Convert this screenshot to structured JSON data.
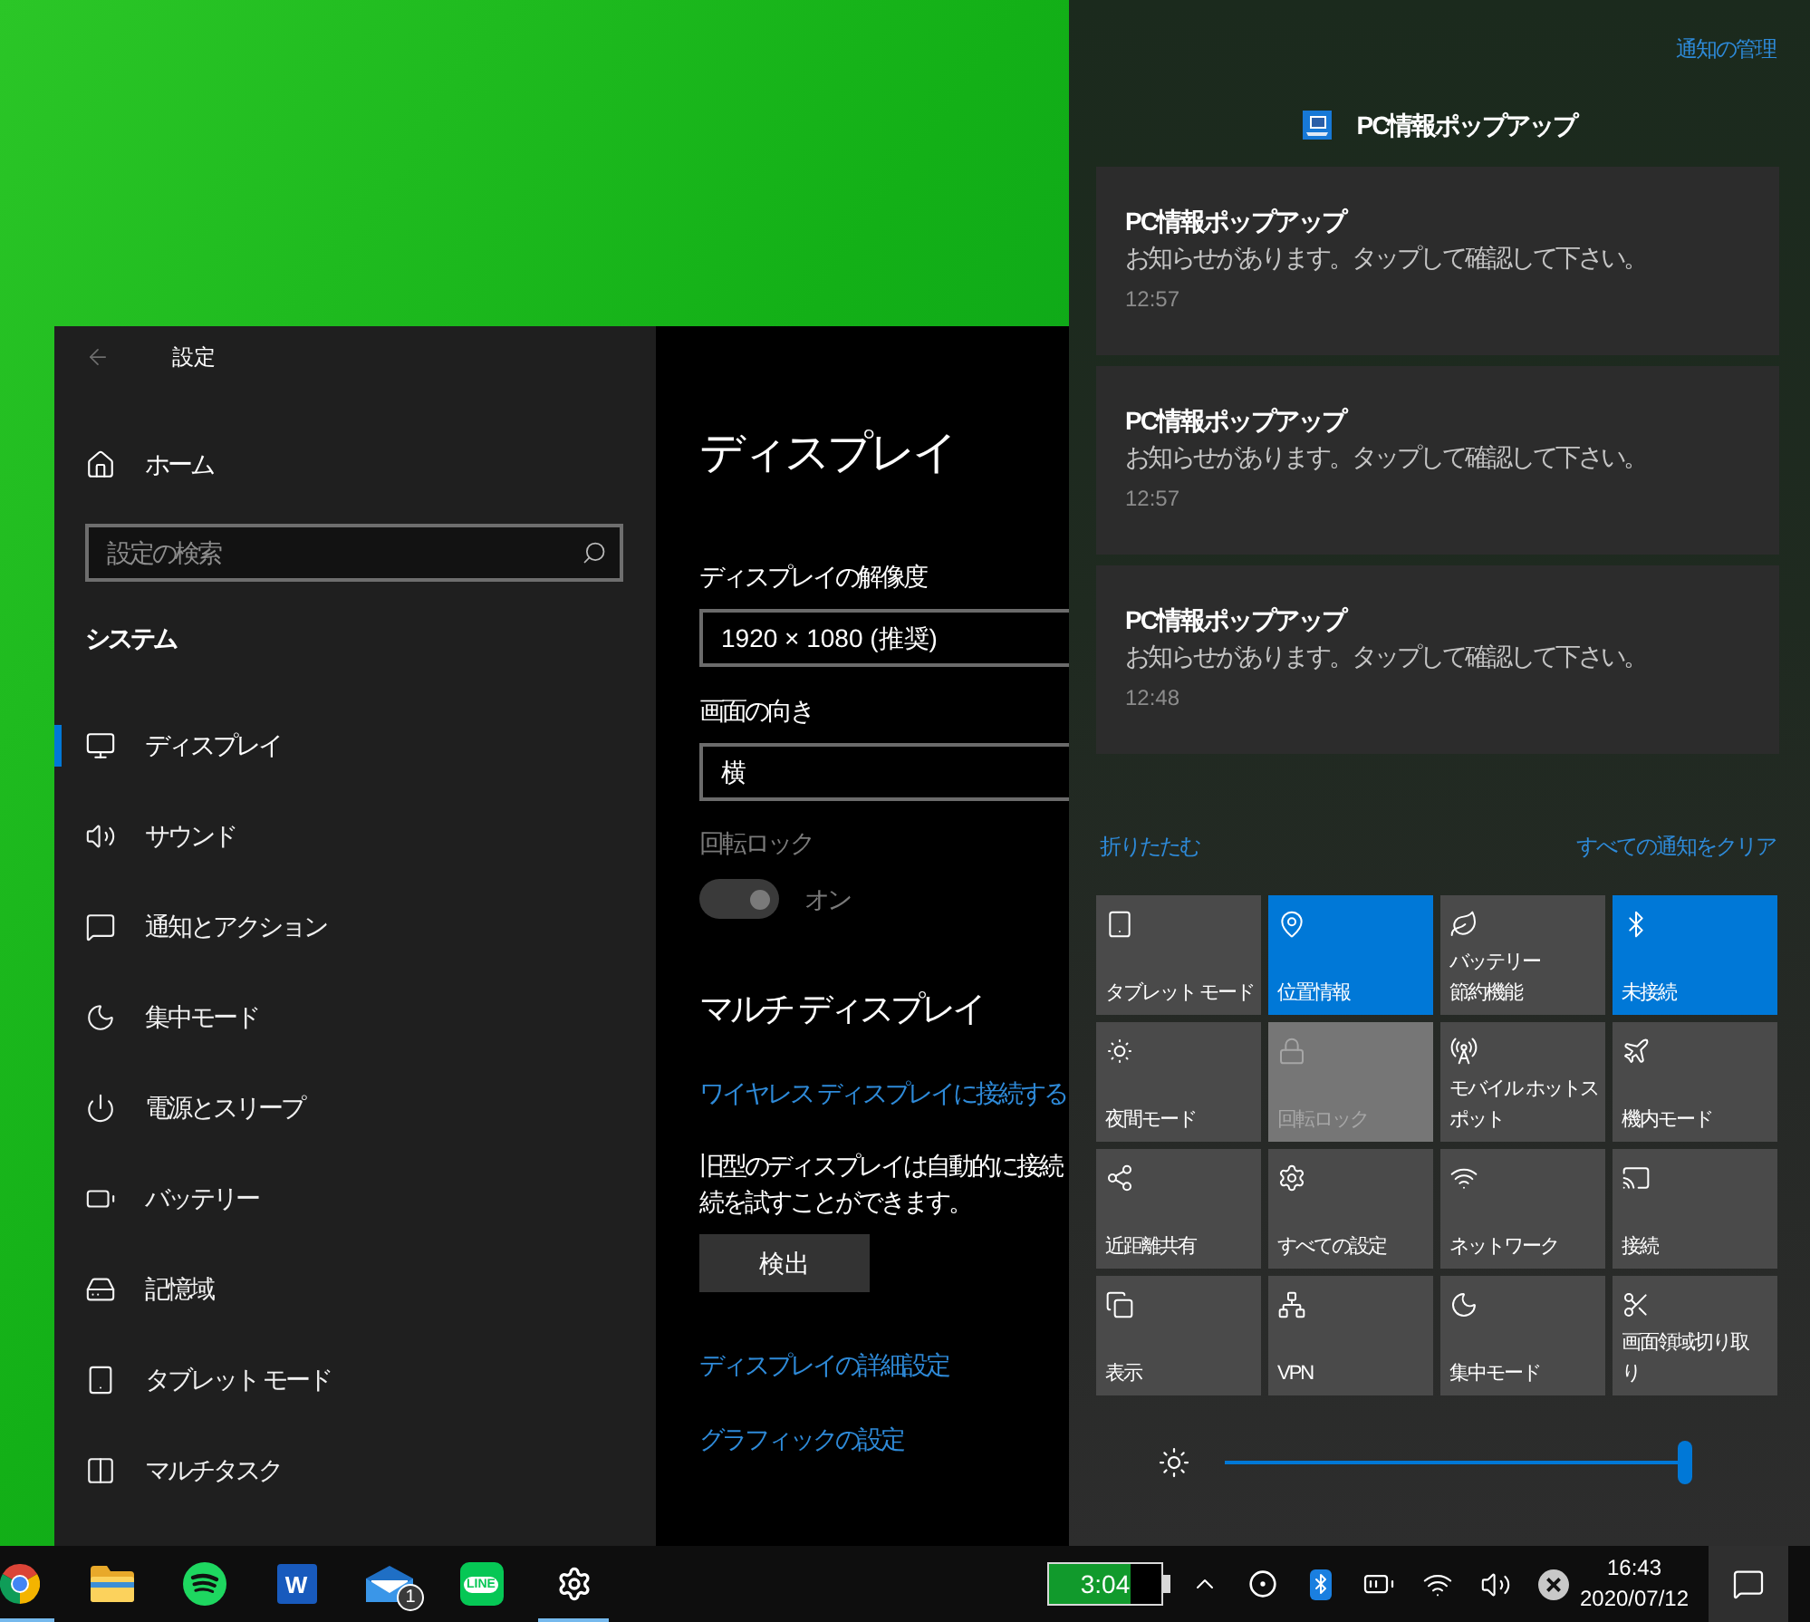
{
  "settings_window": {
    "title": "設定",
    "home": "ホーム",
    "search": {
      "placeholder": "設定の検索"
    },
    "section": "システム",
    "nav_items": [
      {
        "label": "ディスプレイ",
        "selected": true
      },
      {
        "label": "サウンド",
        "selected": false
      },
      {
        "label": "通知とアクション",
        "selected": false
      },
      {
        "label": "集中モード",
        "selected": false
      },
      {
        "label": "電源とスリープ",
        "selected": false
      },
      {
        "label": "バッテリー",
        "selected": false
      },
      {
        "label": "記憶域",
        "selected": false
      },
      {
        "label": "タブレット モード",
        "selected": false
      },
      {
        "label": "マルチタスク",
        "selected": false
      }
    ],
    "page": {
      "heading": "ディスプレイ",
      "resolution": {
        "label": "ディスプレイの解像度",
        "value": "1920 × 1080 (推奨)"
      },
      "orientation": {
        "label": "画面の向き",
        "value": "横"
      },
      "rotation_lock": {
        "label": "回転ロック",
        "on": true,
        "disabled": true,
        "state_text": "オン"
      },
      "multi_display": {
        "heading": "マルチ ディスプレイ",
        "link": "ワイヤレス ディスプレイに接続する",
        "text_lines": [
          "旧型のディスプレイは自動的に接続",
          "続を試すことができます。"
        ],
        "button": "検出"
      },
      "links": [
        "ディスプレイの詳細設定",
        "グラフィックの設定"
      ]
    }
  },
  "action_center": {
    "manage_link": "通知の管理",
    "app_name": "PC情報ポップアップ",
    "notifications": [
      {
        "title": "PC情報ポップアップ",
        "body": "お知らせがあります。タップして確認して下さい。",
        "time": "12:57"
      },
      {
        "title": "PC情報ポップアップ",
        "body": "お知らせがあります。タップして確認して下さい。",
        "time": "12:57"
      },
      {
        "title": "PC情報ポップアップ",
        "body": "お知らせがあります。タップして確認して下さい。",
        "time": "12:48"
      }
    ],
    "collapse_link": "折りたたむ",
    "clear_link": "すべての通知をクリア",
    "quick_actions": [
      {
        "label_lines": [
          "タブレット モード"
        ],
        "on": false,
        "disabled": false
      },
      {
        "label_lines": [
          "位置情報"
        ],
        "on": true,
        "disabled": false
      },
      {
        "label_lines": [
          "バッテリー",
          "節約機能"
        ],
        "on": false,
        "disabled": false
      },
      {
        "label_lines": [
          "未接続"
        ],
        "on": true,
        "disabled": false
      },
      {
        "label_lines": [
          "夜間モード"
        ],
        "on": false,
        "disabled": false
      },
      {
        "label_lines": [
          "回転ロック"
        ],
        "on": false,
        "disabled": true
      },
      {
        "label_lines": [
          "モバイル ホットス",
          "ポット"
        ],
        "on": false,
        "disabled": false
      },
      {
        "label_lines": [
          "機内モード"
        ],
        "on": false,
        "disabled": false
      },
      {
        "label_lines": [
          "近距離共有"
        ],
        "on": false,
        "disabled": false
      },
      {
        "label_lines": [
          "すべての設定"
        ],
        "on": false,
        "disabled": false
      },
      {
        "label_lines": [
          "ネットワーク"
        ],
        "on": false,
        "disabled": false
      },
      {
        "label_lines": [
          "接続"
        ],
        "on": false,
        "disabled": false
      },
      {
        "label_lines": [
          "表示"
        ],
        "on": false,
        "disabled": false
      },
      {
        "label_lines": [
          "VPN"
        ],
        "on": false,
        "disabled": false
      },
      {
        "label_lines": [
          "集中モード"
        ],
        "on": false,
        "disabled": false
      },
      {
        "label_lines": [
          "画面領域切り取",
          "り"
        ],
        "on": false,
        "disabled": false
      }
    ],
    "brightness": {
      "level": 1
    }
  },
  "taskbar": {
    "apps": [
      {
        "running": true
      },
      {
        "running": false
      },
      {
        "running": false
      },
      {
        "running": false,
        "logo_text": "W"
      },
      {
        "running": false,
        "badge": "1"
      },
      {
        "running": false,
        "logo_text": "LINE"
      },
      {
        "running": true
      }
    ],
    "battery_meter": {
      "reading": "3:04",
      "level": 0.72
    },
    "clock": {
      "time": "16:43",
      "date": "2020/07/12"
    }
  }
}
